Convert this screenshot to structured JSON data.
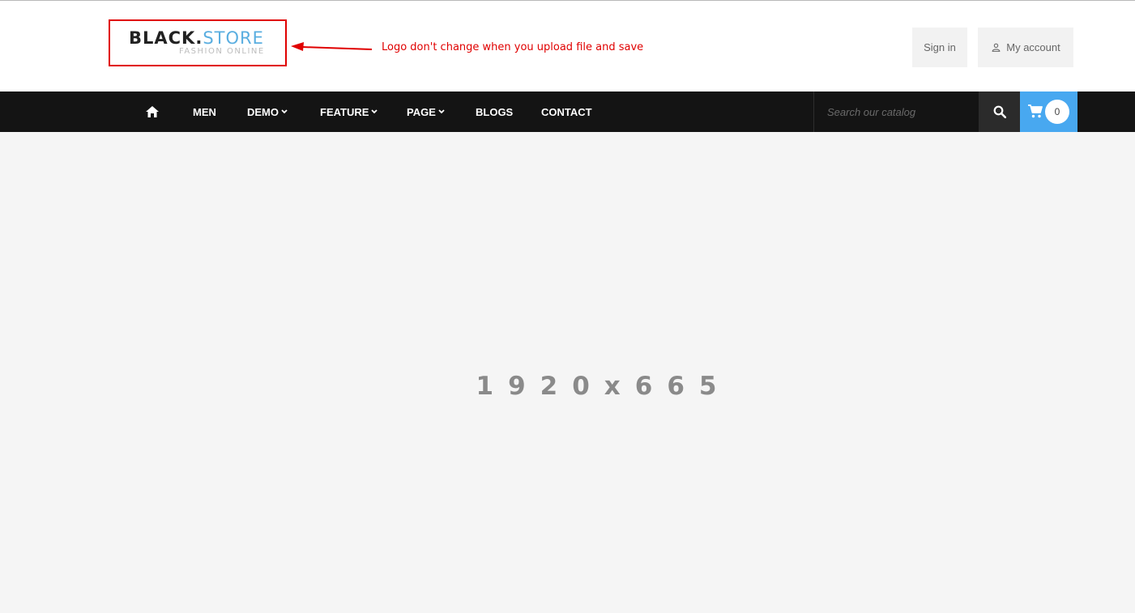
{
  "logo": {
    "brand_bold": "BLACK.",
    "brand_light": "STORE",
    "tagline": "FASHION ONLINE"
  },
  "annotation": {
    "text": "Logo don't change when you upload file and save",
    "color": "#e00000"
  },
  "header": {
    "signin_label": "Sign in",
    "account_label": "My account"
  },
  "nav": {
    "home_icon": "home-icon",
    "items": [
      {
        "label": "MEN",
        "dropdown": false
      },
      {
        "label": "DEMO",
        "dropdown": true
      },
      {
        "label": "FEATURE",
        "dropdown": true
      },
      {
        "label": "PAGE",
        "dropdown": true
      },
      {
        "label": "BLOGS",
        "dropdown": false
      },
      {
        "label": "CONTACT",
        "dropdown": false
      }
    ]
  },
  "search": {
    "placeholder": "Search our catalog",
    "value": ""
  },
  "cart": {
    "count": "0",
    "accent_color": "#48a8f0"
  },
  "banner": {
    "placeholder_text": "1920x665"
  }
}
